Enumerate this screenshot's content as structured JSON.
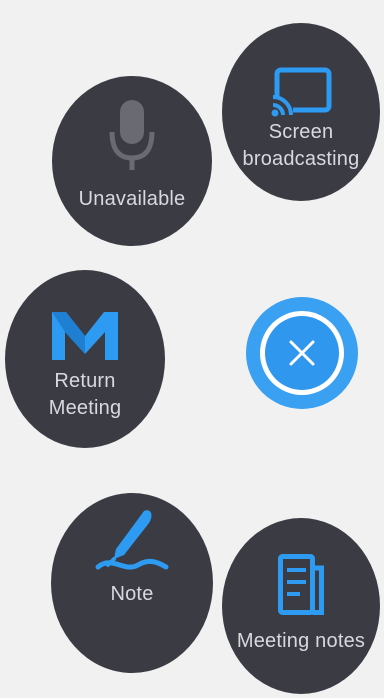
{
  "colors": {
    "background": "#f1f1f1",
    "bubble": "#3b3b44",
    "label": "#d8d8de",
    "accent": "#2f97ee"
  },
  "menu": {
    "screen_broadcasting": {
      "label": "Screen\nbroadcasting",
      "icon": "cast-screen-icon"
    },
    "microphone": {
      "label": "Unavailable",
      "icon": "microphone-icon"
    },
    "return_meeting": {
      "label": "Return\nMeeting",
      "icon": "m-logo-icon"
    },
    "note": {
      "label": "Note",
      "icon": "pen-icon"
    },
    "meeting_notes": {
      "label": "Meeting notes",
      "icon": "document-icon"
    },
    "close": {
      "icon": "close-icon"
    }
  }
}
